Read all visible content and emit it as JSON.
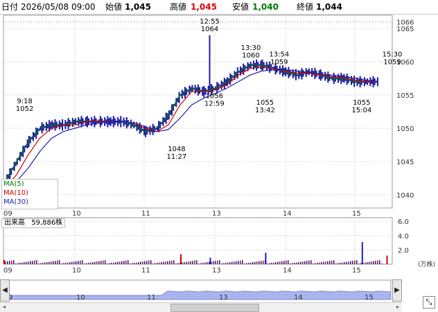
{
  "header": {
    "date_label": "日付",
    "datetime": "2026/05/08 09:00",
    "open_label": "始値",
    "open": "1,045",
    "high_label": "高値",
    "high": "1,045",
    "low_label": "安値",
    "low": "1,040",
    "close_label": "終値",
    "close": "1,044",
    "colors": {
      "high": "#e00000",
      "low": "#007a00"
    }
  },
  "chart_data": [
    {
      "type": "line",
      "panel": "price",
      "x_tick_labels": [
        "09",
        "10",
        "11",
        "13",
        "14",
        "15"
      ],
      "y_ticks": [
        1040,
        1045,
        1050,
        1055,
        1060,
        1065
      ],
      "ylim": [
        1038,
        1067
      ],
      "current_price_marker": 1066,
      "grid": true,
      "series": [
        {
          "name": "MA(5)",
          "color": "#007a00",
          "values": [
            1042,
            1045,
            1048,
            1050,
            1050.5,
            1050.5,
            1051,
            1051,
            1051,
            1051,
            1051,
            1050.5,
            1049.5,
            1050,
            1052,
            1055,
            1056,
            1055.5,
            1056,
            1057,
            1058.5,
            1059.5,
            1059.5,
            1059,
            1058.5,
            1058,
            1058.5,
            1058,
            1057.5,
            1057.5,
            1057,
            1057,
            1057
          ]
        },
        {
          "name": "MA(10)",
          "color": "#cc0000",
          "values": [
            1041,
            1043,
            1046,
            1048.5,
            1050,
            1050.5,
            1050.5,
            1051,
            1051,
            1051,
            1051,
            1050.8,
            1050,
            1049.5,
            1050.5,
            1053.5,
            1055.5,
            1055.5,
            1055.8,
            1056.5,
            1058,
            1059,
            1059.2,
            1059,
            1058.6,
            1058.3,
            1058.3,
            1058,
            1057.8,
            1057.6,
            1057.2,
            1057,
            1057
          ]
        },
        {
          "name": "MA(30)",
          "color": "#2020aa",
          "values": [
            1040.5,
            1042,
            1044,
            1046.5,
            1048.5,
            1049.5,
            1050,
            1050.5,
            1050.8,
            1051,
            1051,
            1050.8,
            1050.3,
            1049.5,
            1049.8,
            1051.5,
            1053.5,
            1054.5,
            1055.2,
            1056,
            1057,
            1058,
            1058.6,
            1058.8,
            1058.8,
            1058.6,
            1058.4,
            1058.2,
            1058,
            1057.8,
            1057.5,
            1057.2,
            1057
          ]
        }
      ],
      "annotations": [
        {
          "time": "9:18",
          "value": 1052,
          "position": "above"
        },
        {
          "time": "11:27",
          "value": 1048,
          "position": "below"
        },
        {
          "time": "12:55",
          "value": 1064,
          "position": "above"
        },
        {
          "time": "12:59",
          "value": 1056,
          "position": "below"
        },
        {
          "time": "13:30",
          "value": 1060,
          "position": "above"
        },
        {
          "time": "13:42",
          "value": 1055,
          "position": "below"
        },
        {
          "time": "13:54",
          "value": 1059,
          "position": "above"
        },
        {
          "time": "15:04",
          "value": 1055,
          "position": "below"
        },
        {
          "time": "15:30",
          "value": 1059,
          "position": "above"
        }
      ]
    },
    {
      "type": "bar",
      "panel": "volume",
      "title": "出来高",
      "total": "59,886株",
      "unit": "(万株)",
      "y_ticks": [
        "2.0",
        "4.0",
        "6.0"
      ],
      "ylim": [
        0,
        6.5
      ],
      "bars_per_session_sample": {
        "highlights": [
          {
            "time": "09:00",
            "value": 0.6,
            "color": "#cc0000"
          },
          {
            "time": "12:30",
            "value": 1.4,
            "color": "#cc0000"
          },
          {
            "time": "12:55",
            "value": 0.9,
            "color": "#2020aa"
          },
          {
            "time": "13:42",
            "value": 1.6,
            "color": "#2020aa"
          },
          {
            "time": "15:04",
            "value": 3.1,
            "color": "#2020aa"
          },
          {
            "time": "15:25",
            "value": 1.2,
            "color": "#cc0000"
          }
        ]
      }
    }
  ],
  "legend": {
    "ma5": "MA(5)",
    "ma10": "MA(10)",
    "ma30": "MA(30)"
  },
  "navigator": {
    "x_tick_labels": [
      "9",
      "10",
      "11",
      "13",
      "14",
      "15"
    ]
  },
  "controls": {
    "left_arrow": "◀",
    "right_arrow": "▶",
    "expand": "⤡"
  }
}
